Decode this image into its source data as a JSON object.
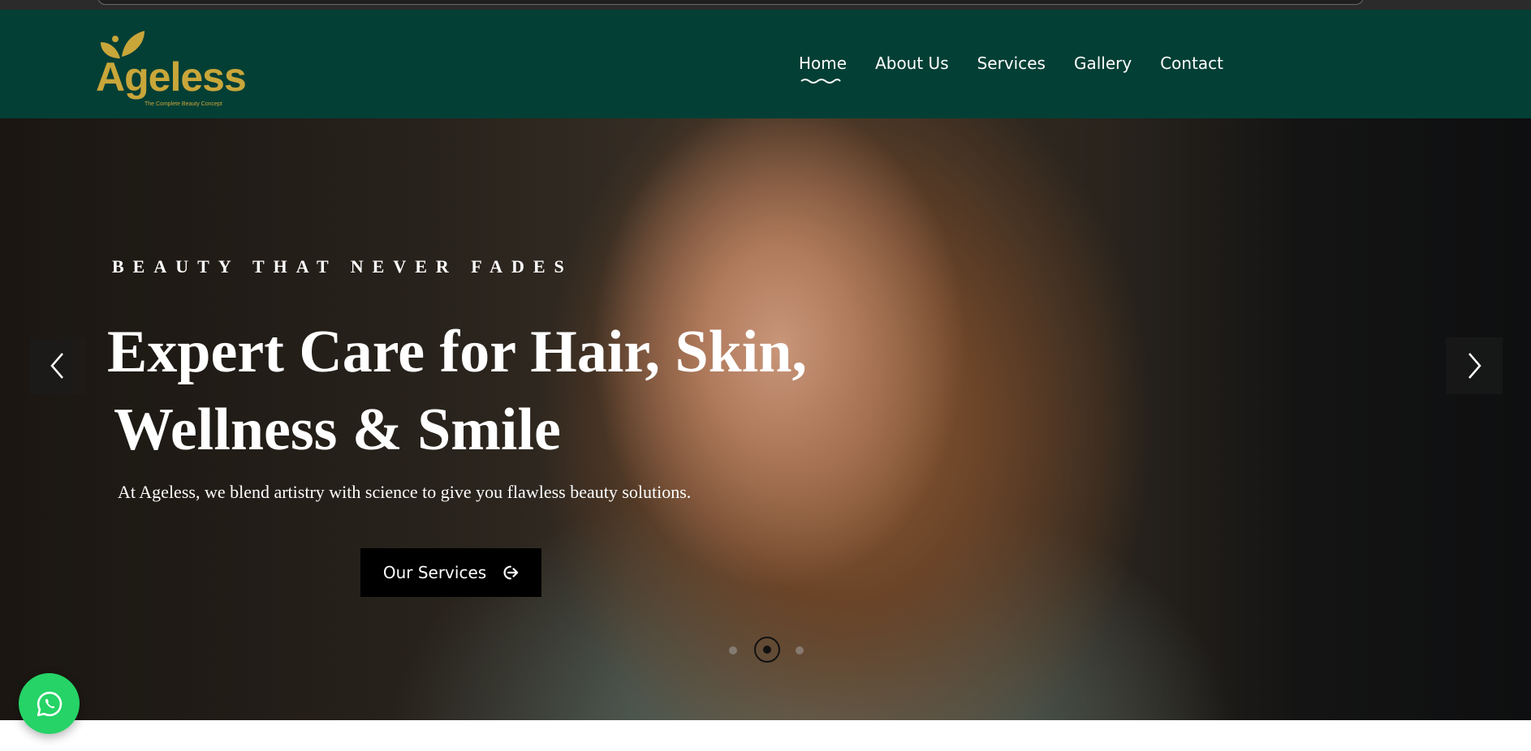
{
  "brand": {
    "name": "Ageless",
    "tagline": "The Complete Beauty Concept",
    "color": "#c9a63a"
  },
  "nav": {
    "items": [
      {
        "label": "Home",
        "active": true
      },
      {
        "label": "About Us",
        "active": false
      },
      {
        "label": "Services",
        "active": false
      },
      {
        "label": "Gallery",
        "active": false
      },
      {
        "label": "Contact",
        "active": false
      }
    ]
  },
  "hero": {
    "eyebrow": "BEAUTY THAT NEVER FADES",
    "headline_line1": "Expert Care for Hair, Skin,",
    "headline_line2": "Wellness & Smile",
    "lede": "At Ageless, we blend artistry with science to give you flawless beauty solutions.",
    "cta_label": "Our Services",
    "cta_icon": "sign-out-arrow-icon",
    "prev_icon": "chevron-left-icon",
    "next_icon": "chevron-right-icon",
    "slides": {
      "count": 3,
      "active_index": 1
    }
  },
  "floating": {
    "whatsapp_icon": "whatsapp-icon",
    "whatsapp_color": "#25d366"
  },
  "colors": {
    "header_bg": "#033f35",
    "accent": "#c9a63a"
  }
}
